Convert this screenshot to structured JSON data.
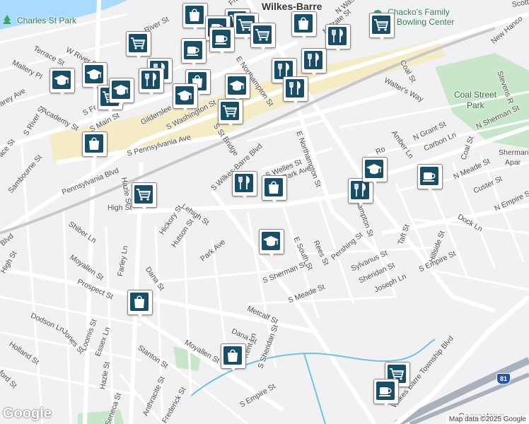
{
  "map": {
    "city_label": "Wilkes-Barre",
    "poi": {
      "charles_st_park": "Charles St Park",
      "chackos_line1": "Chacko's Family",
      "chackos_line2": "Bowling Center",
      "coal_street_park_line1": "Coal Street",
      "coal_street_park_line2": "Park",
      "sherman_apts_line1": "Sherman",
      "sherman_apts_line2": "Apar"
    },
    "streets": {
      "terrace_st": "Terrace St",
      "mallery_pl": "Mallery Pl",
      "w_river_st": "W River St",
      "river_st": "River St",
      "academy_st": "Academy St",
      "s_river_st": "S River St",
      "s_main_st": "S Main St",
      "s_franklin_st": "S Fr",
      "gildersleeve": "Gilderslee",
      "s_washington_st": "S Washington St",
      "s_pennsylvania_ave": "S Pennsylvania Ave",
      "pennsylvania_blvd": "Pennsylvania Blvd",
      "sambourne_st": "Sambourne St",
      "high_st_upper": "High St",
      "hazle_st_upper": "Hazle St",
      "s_wilkes_barre_blvd": "S Wilkes-Barre Blvd",
      "s_welles_st": "S Welles St",
      "e_northampton_st_upper": "E Northampton St",
      "e_northampton_st_mid": "E Northampton St",
      "park_ave_upper": "Park Ave",
      "lehigh_st": "Lehigh St",
      "hickory_st": "Hickory St",
      "hutson_st": "Hutson St",
      "park_ave": "Park Ave",
      "dana_st_upper": "Dana St",
      "shiber_ln": "Shiber Ln",
      "moyallen_st": "Moyallen St",
      "farley_ln": "Farley Ln",
      "prospect_st": "Prospect St",
      "high_st_left": "High St",
      "blvd_left": "Blvd",
      "dodson_ln": "Dodson Ln",
      "jones_st": "Jones St",
      "loomis_st": "Loomis St",
      "essex_ln": "Essex Ln",
      "holland_st": "Holland St",
      "stanton_st": "Stanton St",
      "hazle_st_lower": "Hazle St",
      "moyallen_st_lower": "Moyallen St",
      "metcalf_st": "Metcalf St",
      "dana_st_lower": "Dana St",
      "kent_ln": "Kent Ln",
      "s_sheridan_st": "S Sheridan St",
      "s_empire_st_lower": "S Empire St",
      "anthracite_st": "Anthracite St",
      "frederick_st": "Frederick St",
      "seneca_st": "Seneca St",
      "ford_st": "ford St",
      "s_sherman_st": "S Sherman St",
      "e_south_st": "E South St",
      "s_meade_st": "S Meade St",
      "rees_st": "Rees St",
      "pershing_st": "Pershing St",
      "sylvanus_st": "Sylvanus St",
      "sheridan_st": "Sheridan St",
      "joseph_ln": "Joseph Ln",
      "taft_st": "Taft St",
      "hillside_st": "Hillside St",
      "s_empire_st": "S Empire St",
      "dock_ln": "Dock Ln",
      "n_empire_st": "N Empire St",
      "custer_st": "Custer St",
      "n_meade_st": "N Meade St",
      "n_sherman_st": "N Sherman St",
      "coal_st_right": "Coal St",
      "carbon_ln": "Carbon Ln",
      "n_grant_st": "N Grant St",
      "amber_ln": "Amber Ln",
      "coal_st_upper": "Coal St",
      "walters_way": "Walter's Way",
      "new_hancock": "New Hanco",
      "stevens_r": "Stevens R",
      "scott_st": "Scott St",
      "n_state_st": "N State St",
      "n_washington": "N Was",
      "e_northampton_st_top": "E Northampton St",
      "s_st_bridge": "S St Bridge",
      "rock_st": "Ro",
      "wilkes_barre_township_blvd": "Wilkes Barre Township Blvd",
      "georgetown": "Georgetown",
      "frank": "Fran",
      "carey_ave": "arey Ave",
      "ace_st": "ace St",
      "s_st_left": "S",
      "ford_lower": "ford St"
    },
    "route_shield": "81",
    "markers": [
      {
        "type": "shopping"
      },
      {
        "type": "grocery"
      },
      {
        "type": "cafe"
      },
      {
        "type": "grocery"
      },
      {
        "type": "cafe"
      },
      {
        "type": "grocery"
      },
      {
        "type": "grocery"
      },
      {
        "type": "shopping"
      },
      {
        "type": "grocery"
      },
      {
        "type": "restaurant"
      },
      {
        "type": "restaurant"
      },
      {
        "type": "restaurant"
      },
      {
        "type": "restaurant"
      },
      {
        "type": "restaurant"
      },
      {
        "type": "school"
      },
      {
        "type": "school"
      },
      {
        "type": "grocery"
      },
      {
        "type": "shopping"
      },
      {
        "type": "cafe"
      },
      {
        "type": "school"
      },
      {
        "type": "shopping"
      },
      {
        "type": "school"
      },
      {
        "type": "grocery"
      },
      {
        "type": "restaurant"
      },
      {
        "type": "restaurant"
      },
      {
        "type": "shopping"
      },
      {
        "type": "grocery"
      },
      {
        "type": "school"
      },
      {
        "type": "school"
      },
      {
        "type": "cafe"
      },
      {
        "type": "restaurant"
      },
      {
        "type": "school"
      },
      {
        "type": "shopping"
      },
      {
        "type": "shopping"
      },
      {
        "type": "grocery"
      },
      {
        "type": "cafe"
      }
    ],
    "colors": {
      "background": "#f1f1f3",
      "road": "#ffffff",
      "highway": "#a9b1bd",
      "downtown": "#f3e6b8",
      "park": "#c8e6c9",
      "water": "#aadaff",
      "marker_icon": "#1a4d66"
    }
  },
  "footer": {
    "logo": "Google",
    "attribution": "Map data ©2025 Google"
  }
}
